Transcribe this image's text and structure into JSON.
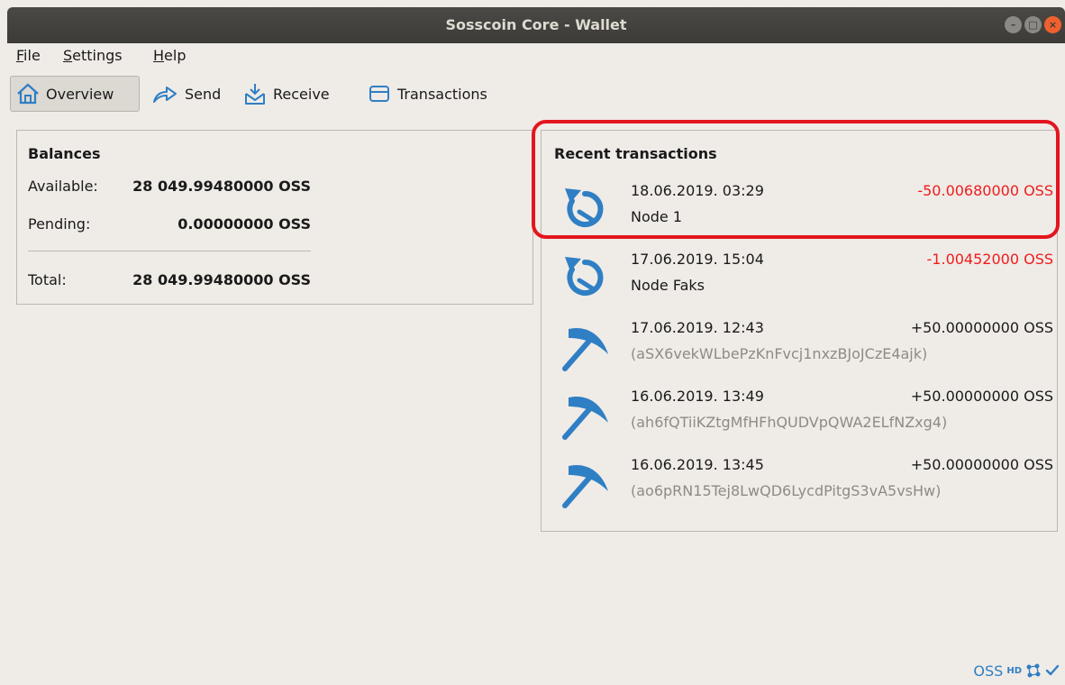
{
  "window": {
    "title": "Sosscoin Core - Wallet"
  },
  "menu": {
    "file": {
      "accel": "F",
      "rest": "ile"
    },
    "settings": {
      "accel": "S",
      "rest": "ettings"
    },
    "help": {
      "accel": "H",
      "rest": "elp"
    }
  },
  "toolbar": {
    "overview": "Overview",
    "send": "Send",
    "receive": "Receive",
    "transactions": "Transactions"
  },
  "balances": {
    "title": "Balances",
    "available_label": "Available:",
    "available_value": "28 049.99480000 OSS",
    "pending_label": "Pending:",
    "pending_value": "0.00000000 OSS",
    "total_label": "Total:",
    "total_value": "28 049.99480000 OSS"
  },
  "recent": {
    "title": "Recent transactions",
    "items": [
      {
        "icon": "send-return-icon",
        "date": "18.06.2019. 03:29",
        "amount": "-50.00680000 OSS",
        "label": "Node 1"
      },
      {
        "icon": "send-return-icon",
        "date": "17.06.2019. 15:04",
        "amount": "-1.00452000 OSS",
        "label": "Node Faks"
      },
      {
        "icon": "pickaxe-icon",
        "date": "17.06.2019. 12:43",
        "amount": "+50.00000000 OSS",
        "label": "(aSX6vekWLbePzKnFvcj1nxzBJoJCzE4ajk)"
      },
      {
        "icon": "pickaxe-icon",
        "date": "16.06.2019. 13:49",
        "amount": "+50.00000000 OSS",
        "label": "(ah6fQTiiKZtgMfHFhQUDVpQWA2ELfNZxg4)"
      },
      {
        "icon": "pickaxe-icon",
        "date": "16.06.2019. 13:45",
        "amount": "+50.00000000 OSS",
        "label": "(ao6pRN15Tej8LwQD6LycdPitgS3vA5vsHw)"
      }
    ]
  },
  "statusbar": {
    "unit": "OSS",
    "hd": "HD"
  },
  "colors": {
    "negative": "#ee1c1c",
    "accent": "#2f7fc4",
    "highlight": "#e3151e"
  }
}
